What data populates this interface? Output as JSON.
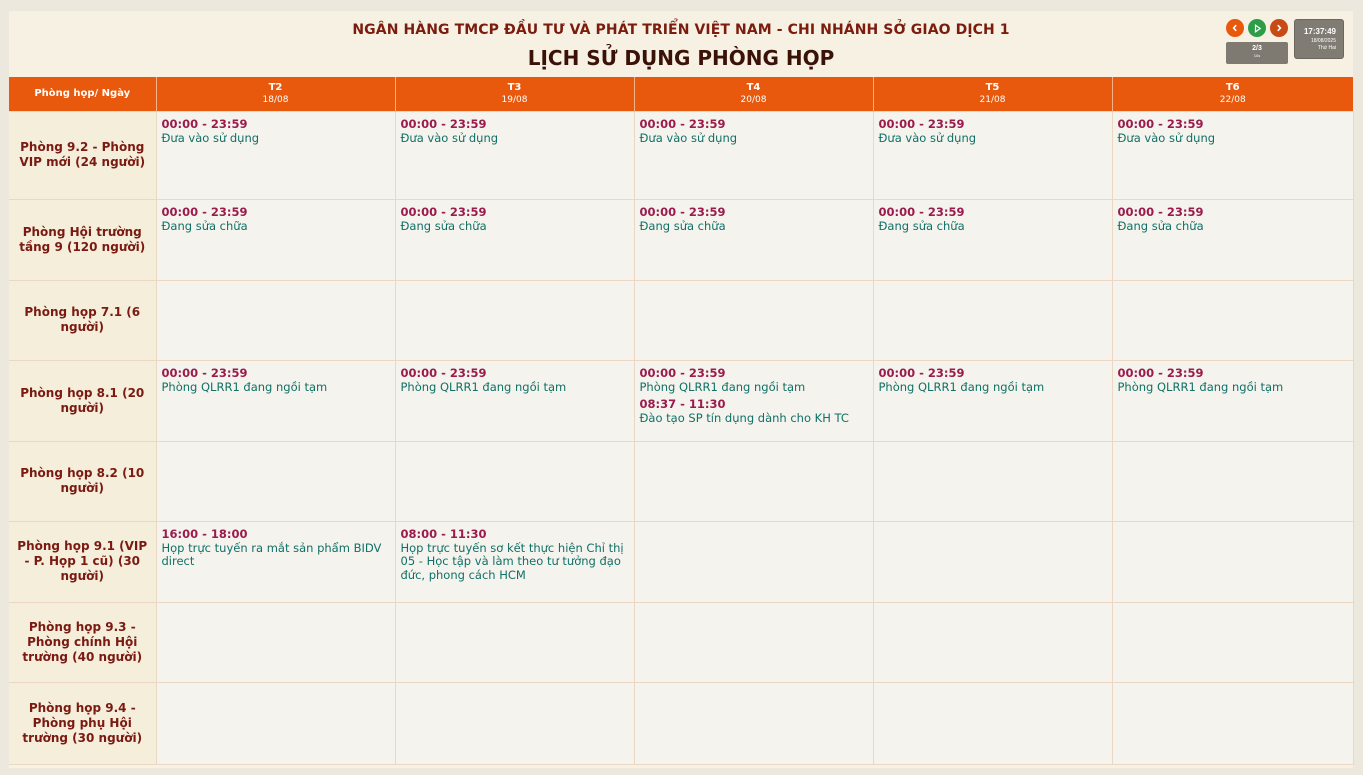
{
  "header": {
    "bank_name": "NGÂN HÀNG TMCP ĐẦU TƯ VÀ PHÁT TRIỂN VIỆT NAM - CHI NHÁNH SỞ GIAO DỊCH 1",
    "title": "LỊCH SỬ DỤNG PHÒNG HỌP"
  },
  "controls": {
    "prev_icon": "chevron-left-icon",
    "play_icon": "play-icon",
    "next_icon": "chevron-right-icon",
    "page": "2/3",
    "page_sub": "10s"
  },
  "clock": {
    "time": "17:37:49",
    "date": "18/08/2025",
    "weekday": "Thứ Hai"
  },
  "colors": {
    "header_bar": "#e9590d",
    "time": "#9a1b4c",
    "desc": "#107066",
    "room": "#7a1a12"
  },
  "table": {
    "corner": "Phòng họp/ Ngày",
    "days": [
      {
        "day": "T2",
        "date": "18/08"
      },
      {
        "day": "T3",
        "date": "19/08"
      },
      {
        "day": "T4",
        "date": "20/08"
      },
      {
        "day": "T5",
        "date": "21/08"
      },
      {
        "day": "T6",
        "date": "22/08"
      }
    ],
    "rows": [
      {
        "room": "Phòng 9.2 - Phòng VIP mới (24 người)",
        "cells": [
          [
            {
              "time": "00:00 - 23:59",
              "desc": "Đưa vào sử dụng"
            }
          ],
          [
            {
              "time": "00:00 - 23:59",
              "desc": "Đưa vào sử dụng"
            }
          ],
          [
            {
              "time": "00:00 - 23:59",
              "desc": "Đưa vào sử dụng"
            }
          ],
          [
            {
              "time": "00:00 - 23:59",
              "desc": "Đưa vào sử dụng"
            }
          ],
          [
            {
              "time": "00:00 - 23:59",
              "desc": "Đưa vào sử dụng"
            }
          ]
        ]
      },
      {
        "room": "Phòng Hội trường tầng 9 (120 người)",
        "cells": [
          [
            {
              "time": "00:00 - 23:59",
              "desc": "Đang sửa chữa"
            }
          ],
          [
            {
              "time": "00:00 - 23:59",
              "desc": "Đang sửa chữa"
            }
          ],
          [
            {
              "time": "00:00 - 23:59",
              "desc": "Đang sửa chữa"
            }
          ],
          [
            {
              "time": "00:00 - 23:59",
              "desc": "Đang sửa chữa"
            }
          ],
          [
            {
              "time": "00:00 - 23:59",
              "desc": "Đang sửa chữa"
            }
          ]
        ]
      },
      {
        "room": "Phòng họp 7.1 (6 người)",
        "cells": [
          [],
          [],
          [],
          [],
          []
        ]
      },
      {
        "room": "Phòng họp 8.1 (20 người)",
        "cells": [
          [
            {
              "time": "00:00 - 23:59",
              "desc": "Phòng QLRR1 đang ngồi tạm"
            }
          ],
          [
            {
              "time": "00:00 - 23:59",
              "desc": "Phòng QLRR1 đang ngồi tạm"
            }
          ],
          [
            {
              "time": "00:00 - 23:59",
              "desc": "Phòng QLRR1 đang ngồi tạm"
            },
            {
              "time": "08:37 - 11:30",
              "desc": "Đào tạo SP tín dụng dành cho KH TC"
            }
          ],
          [
            {
              "time": "00:00 - 23:59",
              "desc": "Phòng QLRR1 đang ngồi tạm"
            }
          ],
          [
            {
              "time": "00:00 - 23:59",
              "desc": "Phòng QLRR1 đang ngồi tạm"
            }
          ]
        ]
      },
      {
        "room": "Phòng họp 8.2 (10 người)",
        "cells": [
          [],
          [],
          [],
          [],
          []
        ]
      },
      {
        "room": "Phòng họp 9.1 (VIP - P. Họp 1 cũ) (30 người)",
        "cells": [
          [
            {
              "time": "16:00 - 18:00",
              "desc": "Họp trực tuyến ra mắt sản phẩm BIDV direct"
            }
          ],
          [
            {
              "time": "08:00 - 11:30",
              "desc": "Họp trực tuyến sơ kết thực hiện Chỉ thị 05 - Học tập và làm theo tư tưởng đạo đức, phong cách HCM"
            }
          ],
          [],
          [],
          []
        ]
      },
      {
        "room": "Phòng họp 9.3 - Phòng chính Hội trường (40 người)",
        "cells": [
          [],
          [],
          [],
          [],
          []
        ]
      },
      {
        "room": "Phòng họp 9.4 - Phòng phụ Hội trường (30 người)",
        "cells": [
          [],
          [],
          [],
          [],
          []
        ]
      }
    ]
  }
}
